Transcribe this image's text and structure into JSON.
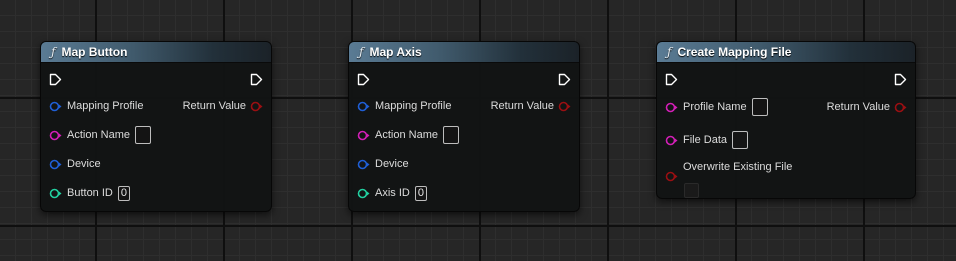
{
  "nodes": [
    {
      "title": "Map Button",
      "function_icon": "ƒ",
      "inputs": [
        {
          "label": "Mapping Profile",
          "pin_color": "#1f5fd6",
          "pin_type": "object"
        },
        {
          "label": "Action Name",
          "pin_color": "#d21fb6",
          "pin_type": "string",
          "widget": "checkbox"
        },
        {
          "label": "Device",
          "pin_color": "#1f5fd6",
          "pin_type": "object"
        },
        {
          "label": "Button ID",
          "pin_color": "#22d0a0",
          "pin_type": "integer",
          "widget": "number",
          "value": "0"
        }
      ],
      "outputs": [
        {
          "label": "Return Value",
          "pin_color": "#9a0f12",
          "pin_type": "boolean"
        }
      ]
    },
    {
      "title": "Map Axis",
      "function_icon": "ƒ",
      "inputs": [
        {
          "label": "Mapping Profile",
          "pin_color": "#1f5fd6",
          "pin_type": "object"
        },
        {
          "label": "Action Name",
          "pin_color": "#d21fb6",
          "pin_type": "string",
          "widget": "checkbox"
        },
        {
          "label": "Device",
          "pin_color": "#1f5fd6",
          "pin_type": "object"
        },
        {
          "label": "Axis ID",
          "pin_color": "#22d0a0",
          "pin_type": "integer",
          "widget": "number",
          "value": "0"
        }
      ],
      "outputs": [
        {
          "label": "Return Value",
          "pin_color": "#9a0f12",
          "pin_type": "boolean"
        }
      ]
    },
    {
      "title": "Create Mapping File",
      "function_icon": "ƒ",
      "inputs": [
        {
          "label": "Profile Name",
          "pin_color": "#d21fb6",
          "pin_type": "string",
          "widget": "checkbox"
        },
        {
          "label": "File Data",
          "pin_color": "#d21fb6",
          "pin_type": "string",
          "widget": "checkbox"
        },
        {
          "label": "Overwrite Existing File",
          "pin_color": "#9a0f12",
          "pin_type": "boolean",
          "widget": "checkbox-below"
        }
      ],
      "outputs": [
        {
          "label": "Return Value",
          "pin_color": "#9a0f12",
          "pin_type": "boolean"
        }
      ]
    }
  ]
}
